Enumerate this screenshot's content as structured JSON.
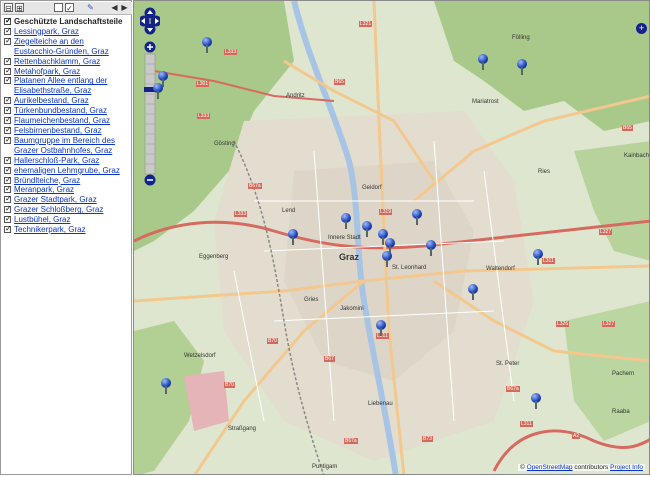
{
  "sidebar": {
    "toolbar": {
      "buttons": [
        {
          "name": "collapse-all-button",
          "symbol": "⊟"
        },
        {
          "name": "expand-all-button",
          "symbol": "⊞"
        },
        {
          "name": "hide-all-button",
          "symbol": ""
        },
        {
          "name": "show-all-button",
          "symbol": "✓"
        },
        {
          "name": "tools-button",
          "symbol": "✎"
        },
        {
          "name": "prev-button",
          "symbol": "◀"
        },
        {
          "name": "next-button",
          "symbol": "▶"
        }
      ]
    },
    "group_title": "Geschützte Landschaftsteile",
    "items": [
      "Lessingpark, Graz",
      "Ziegelteiche an den Eustacchio-Gründen, Graz",
      "Rettenbachklamm, Graz",
      "Metahofpark, Graz",
      "Platanen Allee entlang der Elisabethstraße, Graz",
      "Aurikelbestand, Graz",
      "Türkenbundbestand, Graz",
      "Flaumeichenbestand, Graz",
      "Felsbirnenbestand, Graz",
      "Baumgruppe im Bereich des Grazer Ostbahnhofes, Graz",
      "Hallerschloß-Park, Graz",
      "ehemaligen Lehmgrube, Graz",
      "Bründlteiche, Graz",
      "Meranpark, Graz",
      "Grazer Stadtpark, Graz",
      "Grazer Schloßberg, Graz",
      "Lustbühel, Graz",
      "Technikerpark, Graz"
    ]
  },
  "map": {
    "place_labels": [
      "Andritz",
      "Gösting",
      "Geidorf",
      "Lend",
      "Innere Stadt",
      "Graz",
      "St. Leonhard",
      "Waltendorf",
      "Eggenberg",
      "Gries",
      "Jakomini",
      "Wetzelsdorf",
      "St. Peter",
      "Liebenau",
      "Straßgang",
      "Puntigam",
      "Mariatrost",
      "Fölling",
      "Ries",
      "Kainbach",
      "Raaba",
      "Pachern"
    ],
    "road_labels": [
      "L333",
      "L301",
      "L333",
      "L321",
      "B67a",
      "L333",
      "B70",
      "B70",
      "B67",
      "L311",
      "B73",
      "B67a",
      "B65",
      "L327",
      "L311",
      "L326",
      "L327",
      "L311",
      "B67a",
      "A2",
      "B65",
      "L319"
    ],
    "markers_count": 18,
    "attribution": {
      "prefix": "© ",
      "osm_link": "OpenStreetMap",
      "middle": " contributors ",
      "project_link": "Project Info"
    },
    "colors": {
      "forest": "#a9c98a",
      "urban": "#e0dccd",
      "motorway": "#d66a5f",
      "primary_road": "#f3c88e",
      "river": "#a7c4e5",
      "marker": "#173fb0"
    }
  }
}
